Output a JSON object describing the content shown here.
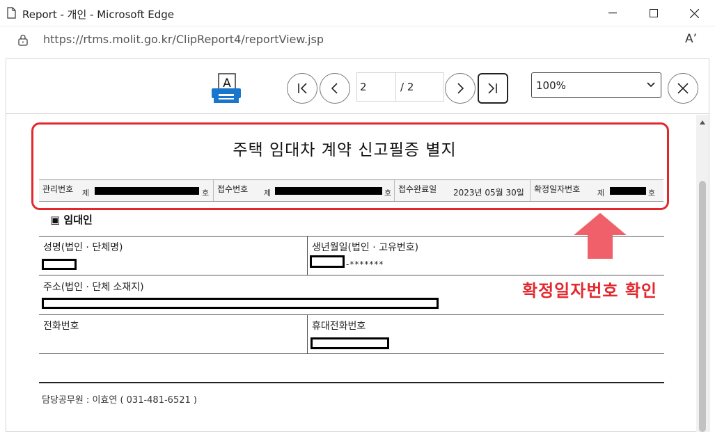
{
  "window": {
    "title": "Report - 개인 - Microsoft Edge",
    "minimize_icon": "minimize-icon",
    "maximize_icon": "maximize-icon",
    "close_icon": "close-icon"
  },
  "address_bar": {
    "url": "https://rtms.molit.go.kr/ClipReport4/reportView.jsp"
  },
  "viewer_toolbar": {
    "current_page": "2",
    "total_pages": "/ 2",
    "zoom": "100%",
    "print_icon_letter": "A"
  },
  "report": {
    "title": "주택 임대차 계약 신고필증 별지",
    "info": {
      "mgmt_label": "관리번호",
      "mgmt_prefix": "제",
      "mgmt_suffix": "호",
      "receipt_label": "접수번호",
      "receipt_prefix": "제",
      "receipt_suffix": "호",
      "completion_label": "접수완료일",
      "completion_date": "2023년 05월 30일",
      "fixed_date_label": "확정일자번호",
      "fixed_date_prefix": "제",
      "fixed_date_suffix": "호"
    },
    "section_title": "▣ 임대인",
    "fields": {
      "name_label": "성명(법인 · 단체명)",
      "birth_label": "생년월일(법인 · 고유번호)",
      "birth_masked": "-*******",
      "address_label": "주소(법인 · 단체 소재지)",
      "phone_label": "전화번호",
      "mobile_label": "휴대전화번호"
    },
    "footer": "담당공무원 : 이효연 ( 031-481-6521 )"
  },
  "annotation": {
    "callout": "확정일자번호 확인",
    "accent_color": "#e3282d"
  }
}
